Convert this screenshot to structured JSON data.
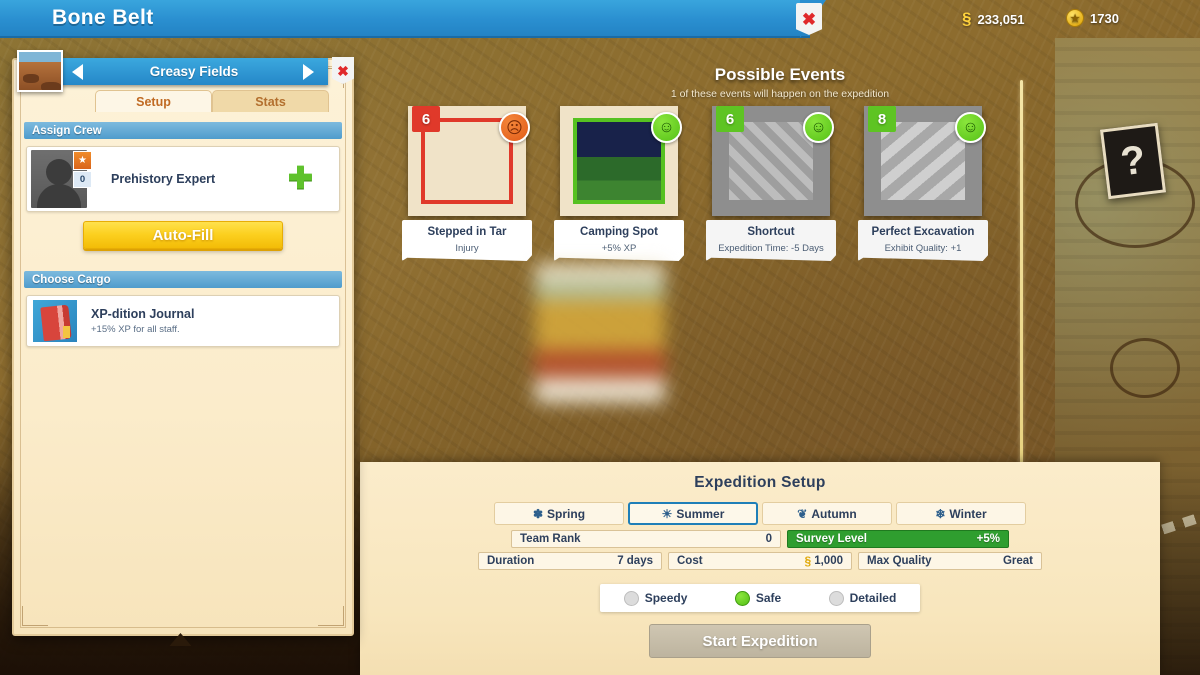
{
  "header": {
    "title": "Bone Belt",
    "close_icon": "close-x-icon",
    "cash_icon": "cash-icon",
    "cash_value": "233,051",
    "coin_icon": "coin-icon",
    "coin_value": "1730"
  },
  "region": {
    "name": "Greasy Fields",
    "prev_icon": "chevron-left-icon",
    "next_icon": "chevron-right-icon",
    "close_icon": "close-x-icon",
    "thumbnail_icon": "region-thumbnail"
  },
  "tabs": [
    {
      "label": "Setup",
      "active": true
    },
    {
      "label": "Stats",
      "active": false
    }
  ],
  "assign_crew": {
    "header": "Assign Crew",
    "slot": {
      "role": "Prehistory Expert",
      "rank_badge": "0",
      "level_badge": "0",
      "add_icon": "plus-icon",
      "portrait_icon": "avatar-silhouette"
    },
    "autofill_label": "Auto-Fill"
  },
  "choose_cargo": {
    "header": "Choose Cargo",
    "item": {
      "name": "XP-dition Journal",
      "description": "+15% XP for all staff.",
      "icon": "journal-book-icon"
    }
  },
  "events": {
    "title": "Possible Events",
    "subtitle": "1 of these events will happen on the expedition",
    "cards": [
      {
        "number": "6",
        "name": "Stepped in Tar",
        "effect": "Injury",
        "mood": "bad",
        "mood_icon": "angry-face-icon",
        "locked": false,
        "accent": "#e0392a"
      },
      {
        "number": "",
        "name": "Camping Spot",
        "effect": "+5% XP",
        "mood": "good",
        "mood_icon": "happy-face-icon",
        "locked": false,
        "accent": "#56c121"
      },
      {
        "number": "6",
        "name": "Shortcut",
        "effect": "Expedition Time: -5 Days",
        "mood": "good",
        "mood_icon": "happy-face-icon",
        "locked": true,
        "accent": "#5ec423"
      },
      {
        "number": "8",
        "name": "Perfect Excavation",
        "effect": "Exhibit Quality: +1",
        "mood": "good",
        "mood_icon": "happy-face-icon",
        "locked": true,
        "accent": "#5ec423"
      }
    ]
  },
  "setup": {
    "title": "Expedition Setup",
    "seasons": [
      {
        "label": "Spring",
        "icon": "flower-icon",
        "glyph": "✽",
        "selected": false
      },
      {
        "label": "Summer",
        "icon": "sun-icon",
        "glyph": "☀",
        "selected": true
      },
      {
        "label": "Autumn",
        "icon": "leaf-icon",
        "glyph": "❦",
        "selected": false
      },
      {
        "label": "Winter",
        "icon": "snowflake-icon",
        "glyph": "❄",
        "selected": false
      }
    ],
    "team_rank": {
      "label": "Team Rank",
      "value": "0"
    },
    "survey_level": {
      "label": "Survey Level",
      "value": "+5%"
    },
    "duration": {
      "label": "Duration",
      "value": "7 days"
    },
    "cost": {
      "label": "Cost",
      "value": "1,000",
      "currency_icon": "cash-icon"
    },
    "max_quality": {
      "label": "Max Quality",
      "value": "Great"
    },
    "speed_options": [
      {
        "label": "Speedy",
        "selected": false
      },
      {
        "label": "Safe",
        "selected": true
      },
      {
        "label": "Detailed",
        "selected": false
      }
    ],
    "start_label": "Start Expedition"
  },
  "map": {
    "site_marker_glyph": "?",
    "site_marker_icon": "unknown-site-icon"
  },
  "colors": {
    "brand_blue": "#2a8fd0",
    "panel_cream": "#fbeccb",
    "accent_yellow": "#fcd01f",
    "good_green": "#56c121",
    "bad_red": "#e0392a",
    "survey_green": "#2f9e2f"
  }
}
